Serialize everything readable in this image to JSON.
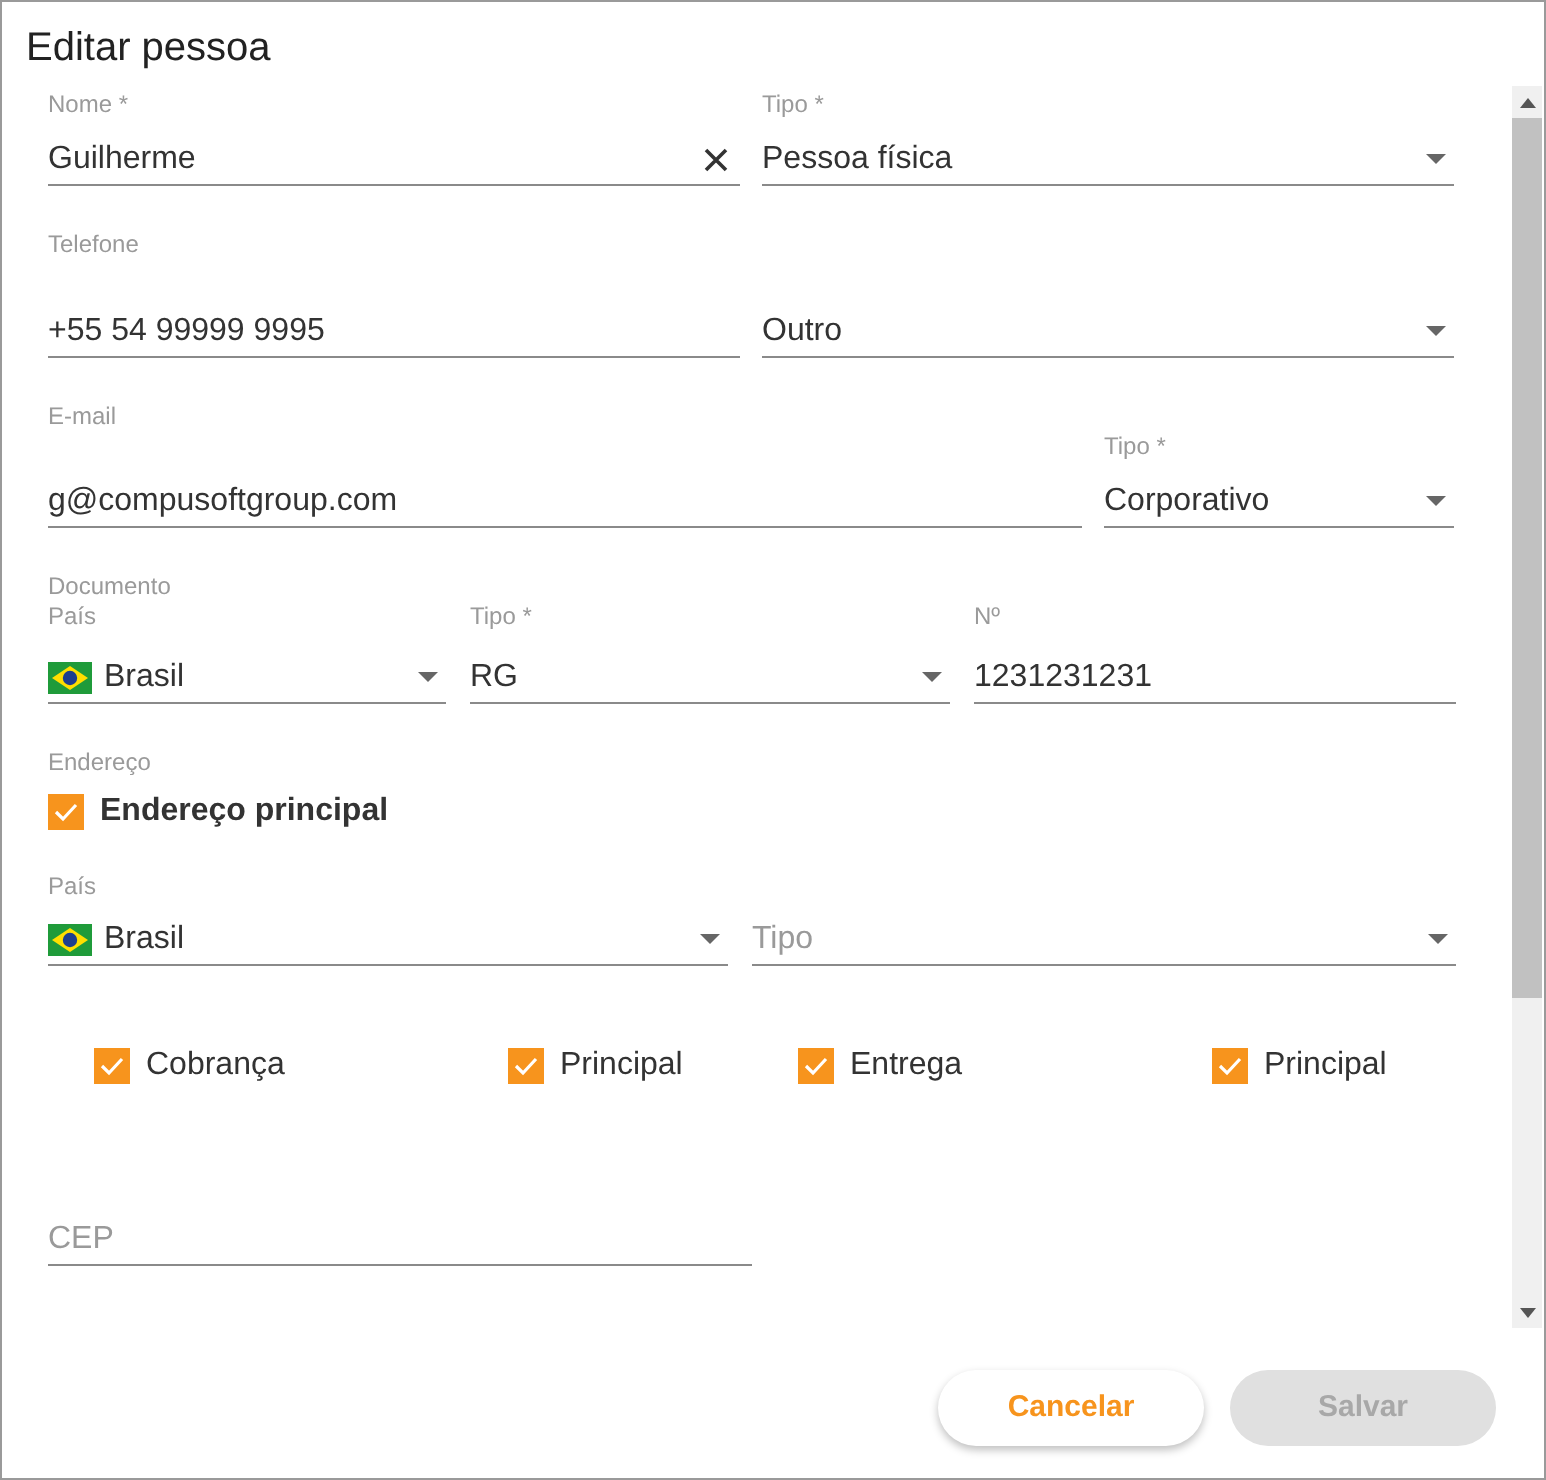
{
  "title": "Editar pessoa",
  "nome": {
    "label": "Nome *",
    "value": "Guilherme"
  },
  "tipo_pessoa": {
    "label": "Tipo *",
    "value": "Pessoa física"
  },
  "telefone": {
    "label": "Telefone",
    "value": "+55 54 99999 9995",
    "tipo_value": "Outro"
  },
  "email": {
    "label": "E-mail",
    "value": "g@compusoftgroup.com",
    "tipo_label": "Tipo *",
    "tipo_value": "Corporativo"
  },
  "documento": {
    "heading": "Documento",
    "pais_label": "País",
    "pais_value": "Brasil",
    "tipo_label": "Tipo *",
    "tipo_value": "RG",
    "numero_label": "Nº",
    "numero_value": "1231231231"
  },
  "endereco": {
    "heading": "Endereço",
    "principal": {
      "label": "Endereço principal",
      "checked": true
    },
    "pais_label": "País",
    "pais_value": "Brasil",
    "tipo_placeholder": "Tipo",
    "flags": [
      {
        "label": "Cobrança",
        "checked": true
      },
      {
        "label": "Principal",
        "checked": true
      },
      {
        "label": "Entrega",
        "checked": true
      },
      {
        "label": "Principal",
        "checked": true
      }
    ],
    "cep_placeholder": "CEP"
  },
  "buttons": [
    {
      "label": "Cancelar",
      "disabled": false
    },
    {
      "label": "Salvar",
      "disabled": true
    }
  ]
}
